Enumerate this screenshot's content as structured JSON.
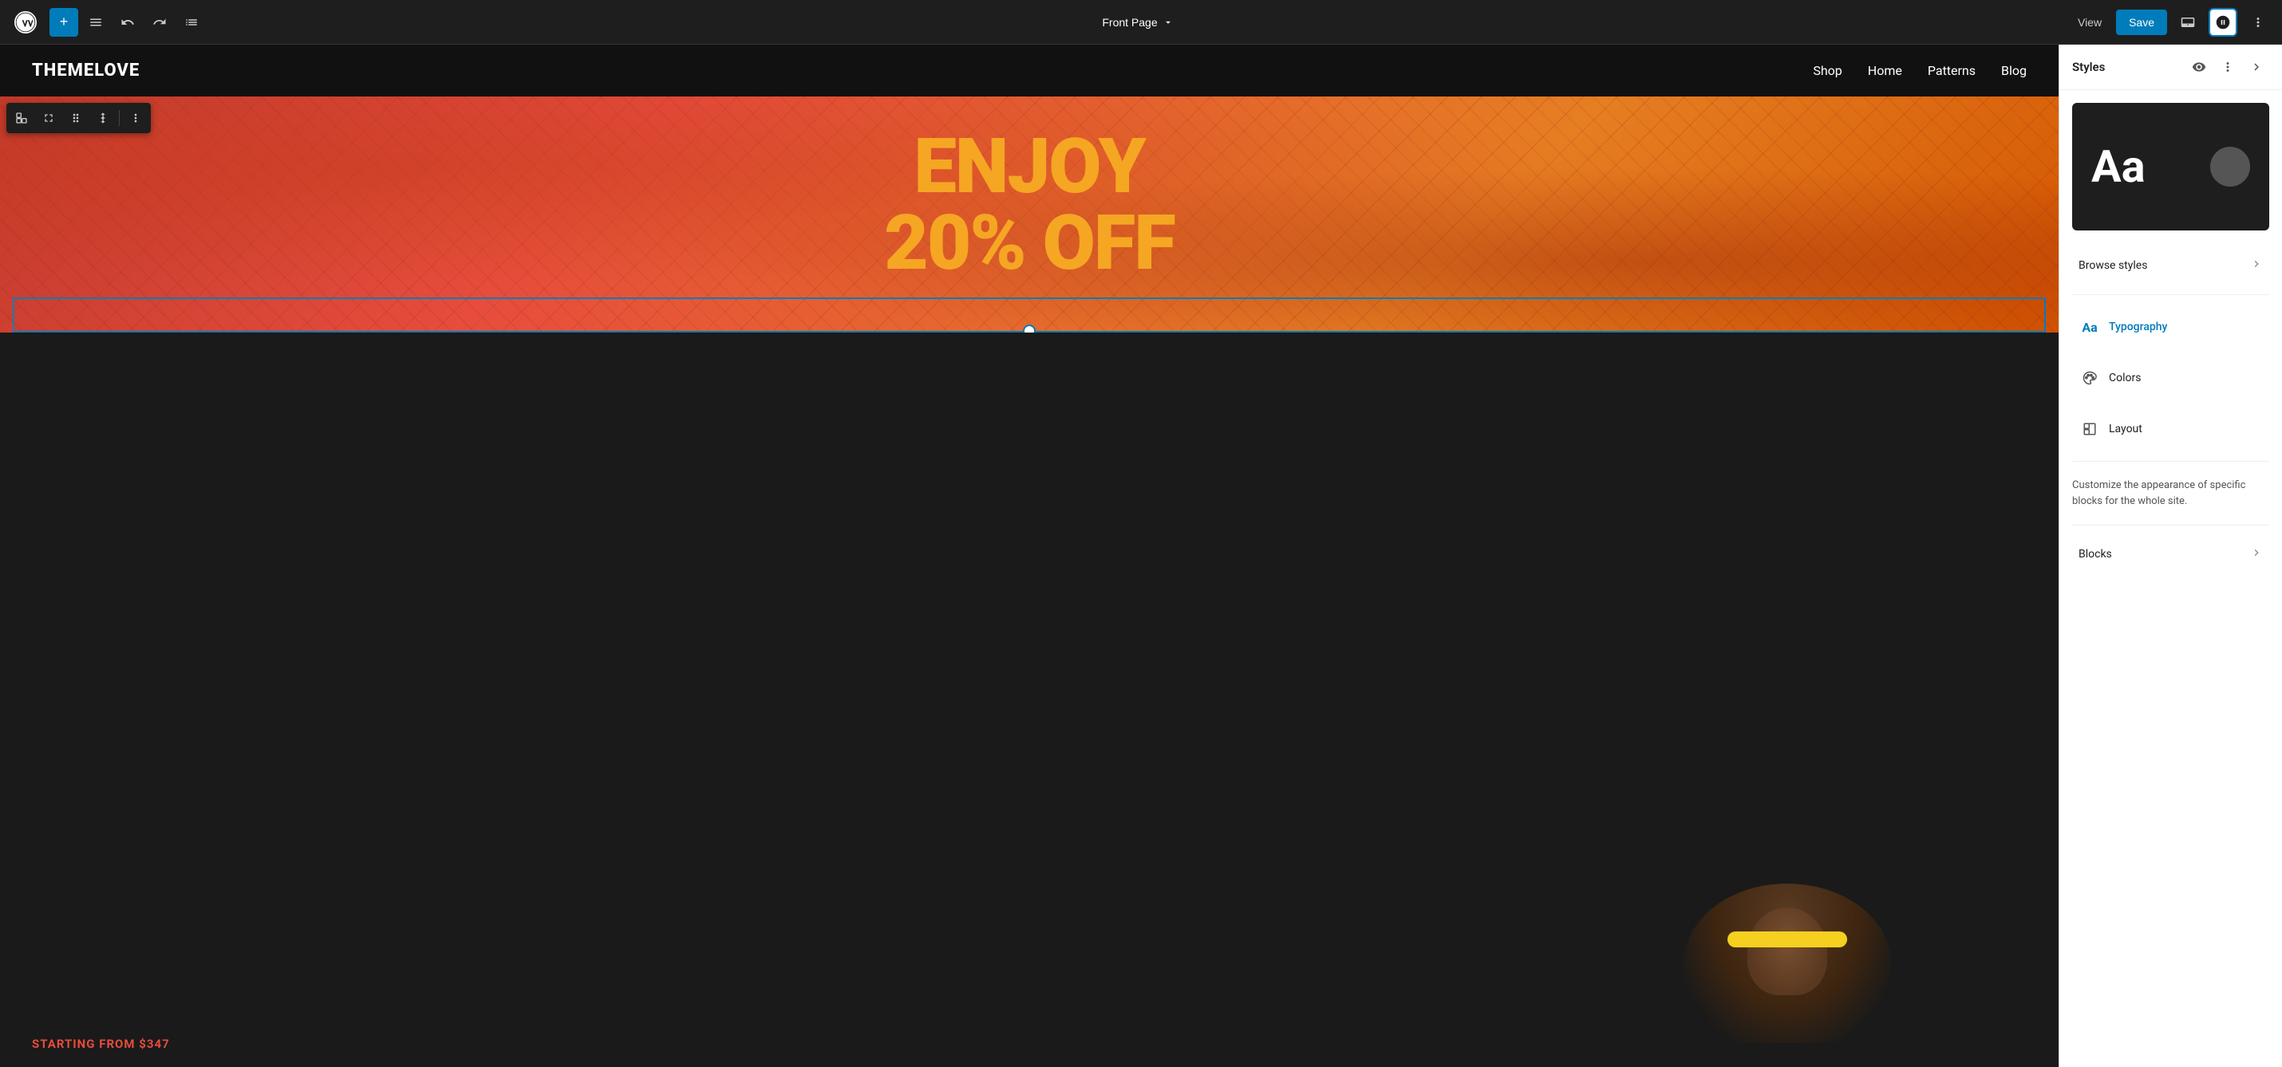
{
  "toolbar": {
    "page_title": "Front Page",
    "view_label": "View",
    "save_label": "Save"
  },
  "site": {
    "brand": "THEMELOVE",
    "nav_items": [
      "Shop",
      "Home",
      "Patterns",
      "Blog"
    ],
    "hero_headline_line1": "ENJOY",
    "hero_headline_line2": "20% OFF",
    "starting_from": "STARTING FROM $347"
  },
  "styles_panel": {
    "title": "Styles",
    "preview_text": "Aa",
    "browse_styles_label": "Browse styles",
    "typography_label": "Typography",
    "colors_label": "Colors",
    "layout_label": "Layout",
    "description": "Customize the appearance of specific blocks for the whole site.",
    "blocks_label": "Blocks"
  }
}
